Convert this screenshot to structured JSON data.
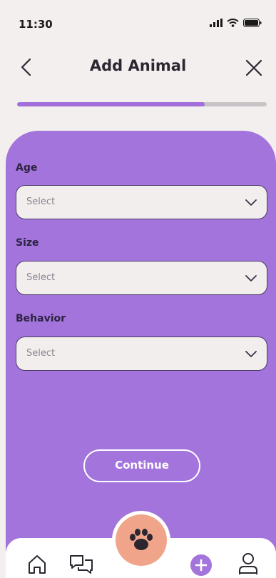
{
  "status_bar": {
    "time": "11:30",
    "icons": [
      "signal-icon",
      "wifi-icon",
      "battery-icon"
    ]
  },
  "header": {
    "title": "Add Animal",
    "back_icon": "chevron-left-icon",
    "close_icon": "close-icon"
  },
  "progress": {
    "fraction": 0.75
  },
  "form": {
    "fields": [
      {
        "label": "Age",
        "value": "Select"
      },
      {
        "label": "Size",
        "value": "Select"
      },
      {
        "label": "Behavior",
        "value": "Select"
      }
    ],
    "continue_label": "Continue"
  },
  "bottom_nav": {
    "items": [
      "home-icon",
      "chat-icon",
      "paw-icon",
      "add-icon",
      "profile-icon"
    ]
  },
  "colors": {
    "accent": "#a374dc",
    "background": "#f3efee",
    "paw_button": "#f0a58a"
  }
}
